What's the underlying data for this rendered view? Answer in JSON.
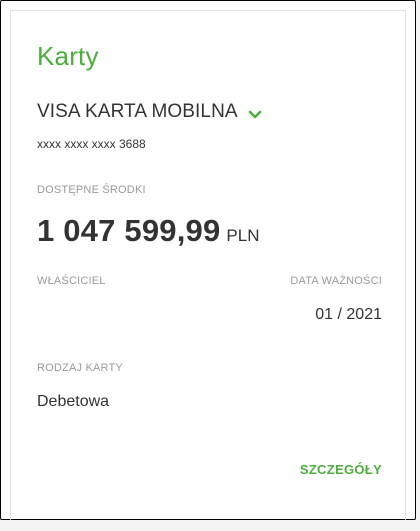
{
  "widget": {
    "title": "Karty",
    "card_name": "VISA KARTA MOBILNA",
    "card_number": "xxxx xxxx xxxx 3688",
    "available_funds_label": "DOSTĘPNE ŚRODKI",
    "balance": "1 047 599,99",
    "currency": "PLN",
    "owner_label": "WŁAŚCICIEL",
    "owner_value": "",
    "expiry_label": "DATA WAŻNOŚCI",
    "expiry_value": "01 / 2021",
    "card_type_label": "RODZAJ KARTY",
    "card_type_value": "Debetowa",
    "details_link": "SZCZEGÓŁY",
    "dropdown_icon": "chevron-down-icon",
    "accent_color": "#4caf3c"
  }
}
